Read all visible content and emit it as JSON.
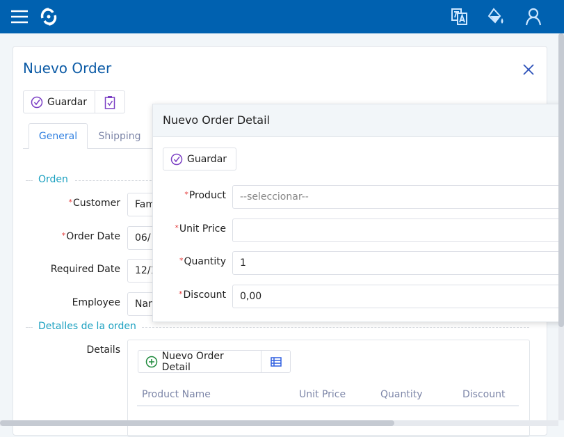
{
  "header": {
    "icons": [
      "menu-icon",
      "logo-icon",
      "translate-icon",
      "paint-bucket-icon",
      "user-icon"
    ],
    "brand_color": "#0061b0"
  },
  "order": {
    "title": "Nuevo Order",
    "save_label": "Guardar",
    "tabs": [
      {
        "label": "General",
        "active": true
      },
      {
        "label": "Shipping",
        "active": false
      }
    ],
    "section_orden": "Orden",
    "fields": [
      {
        "label": "Customer",
        "required": true,
        "value": "Fam"
      },
      {
        "label": "Order Date",
        "required": true,
        "value": "06/"
      },
      {
        "label": "Required Date",
        "required": false,
        "value": "12/1"
      },
      {
        "label": "Employee",
        "required": false,
        "value": "Nan"
      }
    ],
    "section_details": "Detalles de la orden",
    "details_label": "Details",
    "new_detail_label": "Nuevo Order Detail",
    "columns": [
      "Product Name",
      "Unit Price",
      "Quantity",
      "Discount"
    ]
  },
  "modal": {
    "title": "Nuevo Order Detail",
    "save_label": "Guardar",
    "fields": [
      {
        "label": "Product",
        "required": true,
        "value": "",
        "placeholder": "--seleccionar--"
      },
      {
        "label": "Unit Price",
        "required": true,
        "value": ""
      },
      {
        "label": "Quantity",
        "required": true,
        "value": "1"
      },
      {
        "label": "Discount",
        "required": true,
        "value": "0,00"
      }
    ]
  }
}
